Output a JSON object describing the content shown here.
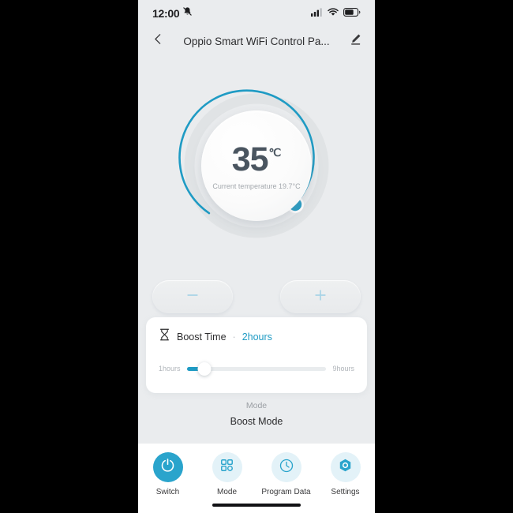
{
  "status_bar": {
    "time": "12:00",
    "mute_icon": "bell-muted-icon",
    "signal_icon": "cellular-signal-icon",
    "wifi_icon": "wifi-icon",
    "battery_icon": "battery-icon"
  },
  "header": {
    "back_icon": "chevron-left-icon",
    "title": "Oppio Smart WiFi Control Pa...",
    "edit_icon": "pencil-edit-icon"
  },
  "dial": {
    "target_temperature": "35",
    "unit": "℃",
    "current_temperature_text": "Current temperature 19.7°C",
    "handle_name": "dial-handle",
    "arc_color": "#1f9bc4",
    "track_color": "#e0e3e5"
  },
  "stepper": {
    "minus_icon": "minus-icon",
    "plus_icon": "plus-icon",
    "icon_color": "#a8d4e6"
  },
  "boost": {
    "icon": "hourglass-icon",
    "label": "Boost Time",
    "separator": "·",
    "value": "2hours",
    "slider": {
      "min_label": "1hours",
      "max_label": "9hours",
      "min": 1,
      "max": 9,
      "value": 2,
      "fill_color": "#1f9bc4"
    }
  },
  "mode": {
    "label": "Mode",
    "value": "Boost Mode"
  },
  "bottom_nav": {
    "items": [
      {
        "label": "Switch",
        "icon": "power-icon",
        "active": true
      },
      {
        "label": "Mode",
        "icon": "grid-squares-icon",
        "active": false
      },
      {
        "label": "Program Data",
        "icon": "clock-icon",
        "active": false
      },
      {
        "label": "Settings",
        "icon": "hex-nut-settings-icon",
        "active": false
      }
    ],
    "active_color": "#2aa4cc",
    "inactive_bg": "#e3f2f8",
    "inactive_icon_color": "#2aa4cc"
  }
}
